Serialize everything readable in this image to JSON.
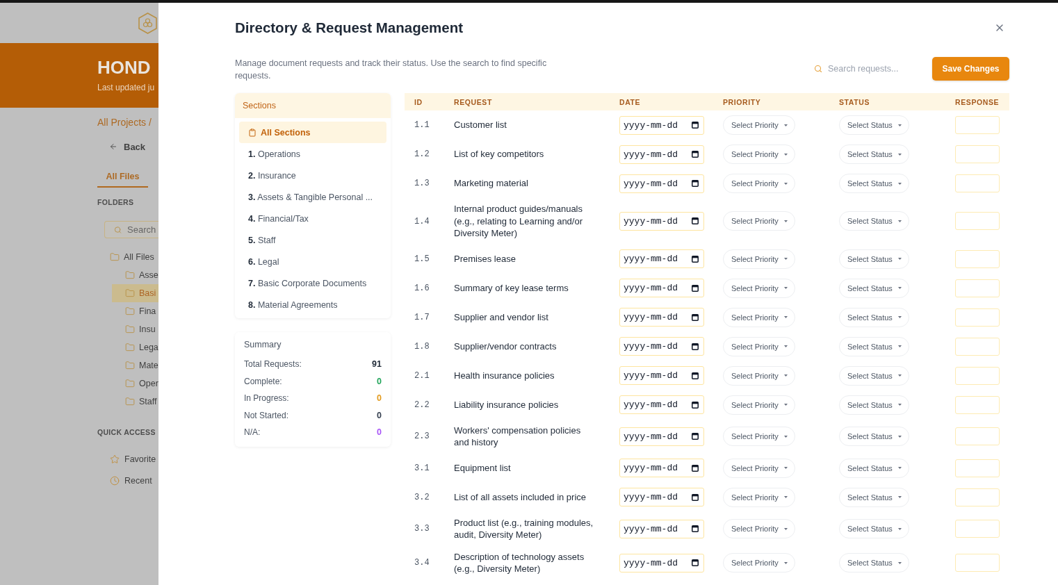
{
  "background_app": {
    "header": {
      "title": "HOND",
      "subtitle": "Last updated ju"
    },
    "breadcrumb": "All Projects /",
    "back_link": "Back",
    "tabs": [
      {
        "label": "All Files",
        "selected": true
      }
    ],
    "folders_heading": "FOLDERS",
    "folder_search": {
      "placeholder": "Search"
    },
    "folders": [
      {
        "label": "All Files",
        "selected": false,
        "children": [
          {
            "label": "Asse",
            "selected": false
          },
          {
            "label": "Basi",
            "selected": true
          },
          {
            "label": "Fina",
            "selected": false
          },
          {
            "label": "Insu",
            "selected": false
          },
          {
            "label": "Lega",
            "selected": false
          },
          {
            "label": "Mate",
            "selected": false
          },
          {
            "label": "Oper",
            "selected": false
          },
          {
            "label": "Staff",
            "selected": false
          }
        ]
      }
    ],
    "quick_access_heading": "QUICK ACCESS",
    "quick_access": [
      {
        "kind": "favorites",
        "label": "Favorite"
      },
      {
        "kind": "recent",
        "label": "Recent"
      }
    ]
  },
  "dialog": {
    "title": "Directory & Request Management",
    "description": "Manage document requests and track their status. Use the search to find specific requests.",
    "search": {
      "placeholder": "Search requests..."
    },
    "save_button": "Save Changes",
    "sections": {
      "heading": "Sections",
      "items": [
        {
          "kind": "all",
          "label": "All Sections",
          "selected": true
        },
        {
          "kind": "section",
          "label": "**1.** Operations",
          "selected": false
        },
        {
          "kind": "section",
          "label": "**2.** Insurance",
          "selected": false
        },
        {
          "kind": "section",
          "label": "**3.** Assets & Tangible Personal ...",
          "selected": false
        },
        {
          "kind": "section",
          "label": "**4.** Financial/Tax",
          "selected": false
        },
        {
          "kind": "section",
          "label": "**5.** Staff",
          "selected": false
        },
        {
          "kind": "section",
          "label": "**6.** Legal",
          "selected": false
        },
        {
          "kind": "section",
          "label": "**7.** Basic Corporate Documents",
          "selected": false
        },
        {
          "kind": "section",
          "label": "**8.** Material Agreements",
          "selected": false
        }
      ]
    },
    "summary": {
      "heading": "Summary",
      "rows": [
        {
          "label": "Total Requests:",
          "value": "91",
          "color": "#1f2937"
        },
        {
          "label": "Complete:",
          "value": "0",
          "color": "#22a55b"
        },
        {
          "label": "In Progress:",
          "value": "0",
          "color": "#e39a1c"
        },
        {
          "label": "Not Started:",
          "value": "0",
          "color": "#374151"
        },
        {
          "label": "N/A:",
          "value": "0",
          "color": "#a855f7"
        }
      ]
    },
    "table": {
      "columns": [
        "ID",
        "REQUEST",
        "DATE",
        "PRIORITY",
        "STATUS",
        "RESPONSE"
      ],
      "rows": [
        {
          "id": "1.1",
          "request": "Customer list",
          "date": {
            "placeholder": "yyyy-mm-dd"
          },
          "priority": "Select Priority",
          "status": "Select Status"
        },
        {
          "id": "1.2",
          "request": "List of key competitors",
          "date": {
            "placeholder": "yyyy-mm-dd"
          },
          "priority": "Select Priority",
          "status": "Select Status"
        },
        {
          "id": "1.3",
          "request": "Marketing material",
          "date": {
            "placeholder": "yyyy-mm-dd"
          },
          "priority": "Select Priority",
          "status": "Select Status"
        },
        {
          "id": "1.4",
          "request": "Internal product guides/manuals (e.g., relating to Learning and/or Diversity Meter)",
          "date": {
            "placeholder": "yyyy-mm-dd"
          },
          "priority": "Select Priority",
          "status": "Select Status"
        },
        {
          "id": "1.5",
          "request": "Premises lease",
          "date": {
            "placeholder": "yyyy-mm-dd"
          },
          "priority": "Select Priority",
          "status": "Select Status"
        },
        {
          "id": "1.6",
          "request": "Summary of key lease terms",
          "date": {
            "placeholder": "yyyy-mm-dd"
          },
          "priority": "Select Priority",
          "status": "Select Status"
        },
        {
          "id": "1.7",
          "request": "Supplier and vendor list",
          "date": {
            "placeholder": "yyyy-mm-dd"
          },
          "priority": "Select Priority",
          "status": "Select Status"
        },
        {
          "id": "1.8",
          "request": "Supplier/vendor contracts",
          "date": {
            "placeholder": "yyyy-mm-dd"
          },
          "priority": "Select Priority",
          "status": "Select Status"
        },
        {
          "id": "2.1",
          "request": "Health insurance policies",
          "date": {
            "placeholder": "yyyy-mm-dd"
          },
          "priority": "Select Priority",
          "status": "Select Status"
        },
        {
          "id": "2.2",
          "request": "Liability insurance policies",
          "date": {
            "placeholder": "yyyy-mm-dd"
          },
          "priority": "Select Priority",
          "status": "Select Status"
        },
        {
          "id": "2.3",
          "request": "Workers' compensation policies and history",
          "date": {
            "placeholder": "yyyy-mm-dd"
          },
          "priority": "Select Priority",
          "status": "Select Status"
        },
        {
          "id": "3.1",
          "request": "Equipment list",
          "date": {
            "placeholder": "yyyy-mm-dd"
          },
          "priority": "Select Priority",
          "status": "Select Status"
        },
        {
          "id": "3.2",
          "request": "List of all assets included in price",
          "date": {
            "placeholder": "yyyy-mm-dd"
          },
          "priority": "Select Priority",
          "status": "Select Status"
        },
        {
          "id": "3.3",
          "request": "Product list (e.g., training modules, audit, Diversity Meter)",
          "date": {
            "placeholder": "yyyy-mm-dd"
          },
          "priority": "Select Priority",
          "status": "Select Status"
        },
        {
          "id": "3.4",
          "request": "Description of technology assets (e.g., Diversity Meter)",
          "date": {
            "placeholder": "yyyy-mm-dd"
          },
          "priority": "Select Priority",
          "status": "Select Status"
        }
      ]
    }
  }
}
